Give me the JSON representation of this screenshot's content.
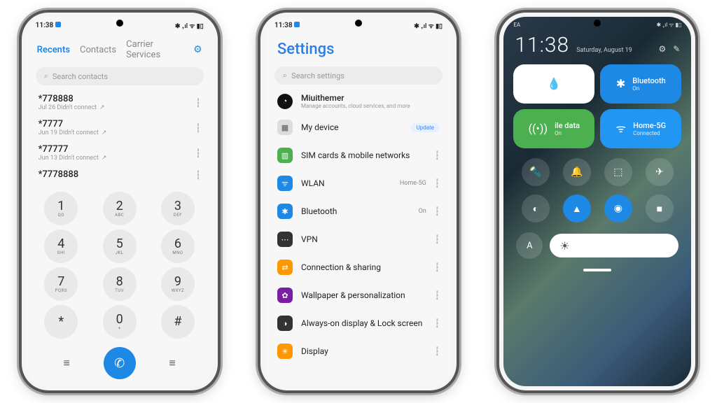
{
  "statusbar": {
    "time": "11:38",
    "icons": "✱ ₊ıl ᯤ ▮▯"
  },
  "dialer": {
    "tabs": [
      "Recents",
      "Contacts",
      "Carrier Services"
    ],
    "search_placeholder": "Search contacts",
    "calls": [
      {
        "number": "*778888",
        "meta": "Jul 26 Didn't connect"
      },
      {
        "number": "*7777",
        "meta": "Jun 19 Didn't connect"
      },
      {
        "number": "*77777",
        "meta": "Jun 13 Didn't connect"
      },
      {
        "number": "*7778888",
        "meta": ""
      }
    ],
    "keys": [
      {
        "d": "1",
        "l": "QO"
      },
      {
        "d": "2",
        "l": "ABC"
      },
      {
        "d": "3",
        "l": "DEF"
      },
      {
        "d": "4",
        "l": "GHI"
      },
      {
        "d": "5",
        "l": "JKL"
      },
      {
        "d": "6",
        "l": "MNO"
      },
      {
        "d": "7",
        "l": "PQRS"
      },
      {
        "d": "8",
        "l": "TUV"
      },
      {
        "d": "9",
        "l": "WXYZ"
      },
      {
        "d": "*",
        "l": ""
      },
      {
        "d": "0",
        "l": "+"
      },
      {
        "d": "#",
        "l": ""
      }
    ]
  },
  "settings": {
    "title": "Settings",
    "search_placeholder": "Search settings",
    "account": {
      "name": "Miuithemer",
      "sub": "Manage accounts, cloud services, and more"
    },
    "update_label": "Update",
    "items": [
      {
        "icon": "▦",
        "bg": "#ddd",
        "fg": "#555",
        "label": "My device",
        "right": "",
        "badge": true
      },
      {
        "icon": "▥",
        "bg": "#4caf50",
        "label": "SIM cards & mobile networks",
        "right": ""
      },
      {
        "icon": "ᯤ",
        "bg": "#1e88e5",
        "label": "WLAN",
        "right": "Home-5G"
      },
      {
        "icon": "✱",
        "bg": "#1e88e5",
        "label": "Bluetooth",
        "right": "On"
      },
      {
        "icon": "⋯",
        "bg": "#333",
        "label": "VPN",
        "right": ""
      },
      {
        "icon": "⇄",
        "bg": "#ff9800",
        "label": "Connection & sharing",
        "right": ""
      },
      {
        "icon": "✿",
        "bg": "#7b1fa2",
        "label": "Wallpaper & personalization",
        "right": ""
      },
      {
        "icon": "◑",
        "bg": "#333",
        "label": "Always-on display & Lock screen",
        "right": ""
      },
      {
        "icon": "☀",
        "bg": "#ff9800",
        "label": "Display",
        "right": ""
      }
    ]
  },
  "cc": {
    "carrier": "EA",
    "time": "11:38",
    "date": "Saturday, August 19",
    "tiles": [
      {
        "type": "white",
        "icon": "💧",
        "label": "",
        "sub": ""
      },
      {
        "type": "blue",
        "icon": "✱",
        "label": "Bluetooth",
        "sub": "On"
      },
      {
        "type": "green",
        "icon": "((•))",
        "label": "ile data",
        "sub": "On"
      },
      {
        "type": "blue2",
        "icon": "ᯤ",
        "label": "Home-5G",
        "sub": "Connected"
      }
    ],
    "toggles": [
      {
        "icon": "🔦",
        "on": false
      },
      {
        "icon": "🔔",
        "on": false
      },
      {
        "icon": "⬚",
        "on": false
      },
      {
        "icon": "✈",
        "on": false
      },
      {
        "icon": "◐",
        "on": false
      },
      {
        "icon": "▲",
        "on": true
      },
      {
        "icon": "◉",
        "on": true
      },
      {
        "icon": "■",
        "on": false
      }
    ],
    "font_label": "A",
    "bright_icon": "☀"
  }
}
